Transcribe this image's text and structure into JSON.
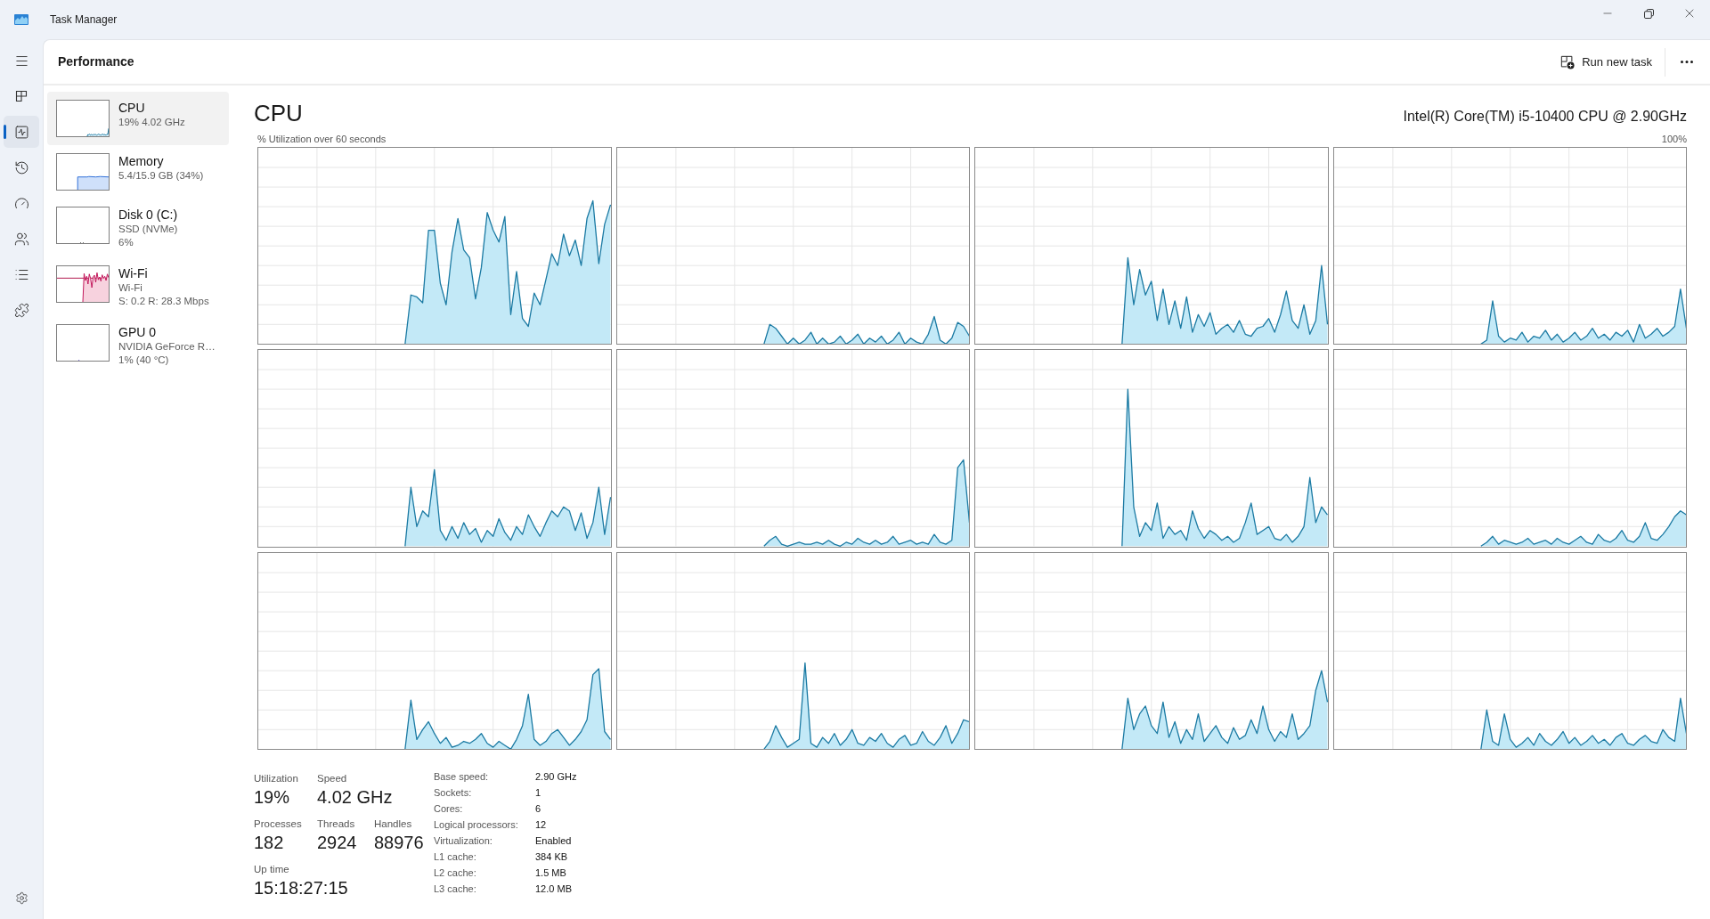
{
  "window": {
    "title": "Task Manager"
  },
  "nav": [
    {
      "selected": false
    },
    {
      "selected": true
    },
    {
      "selected": false
    },
    {
      "selected": false
    },
    {
      "selected": false
    },
    {
      "selected": false
    },
    {
      "selected": false
    }
  ],
  "header": {
    "title": "Performance",
    "action": "Run new task"
  },
  "devices": [
    {
      "kind": "cpu",
      "name": "CPU",
      "details": [
        "19% 4.02 GHz"
      ],
      "selected": true
    },
    {
      "kind": "memory",
      "name": "Memory",
      "details": [
        "5.4/15.9 GB (34%)"
      ],
      "selected": false
    },
    {
      "kind": "disk",
      "name": "Disk 0 (C:)",
      "details": [
        "SSD (NVMe)",
        "6%"
      ],
      "selected": false
    },
    {
      "kind": "network",
      "name": "Wi-Fi",
      "details": [
        "Wi-Fi",
        "S: 0.2 R: 28.3 Mbps"
      ],
      "selected": false
    },
    {
      "kind": "gpu",
      "name": "GPU 0",
      "details": [
        "NVIDIA GeForce R…",
        "1% (40 °C)"
      ],
      "selected": false
    }
  ],
  "detail": {
    "title": "CPU",
    "model": "Intel(R) Core(TM) i5-10400 CPU @ 2.90GHz",
    "graph_caption": "% Utilization over 60 seconds",
    "graph_max": "100%"
  },
  "stats": [
    [
      {
        "label": "Utilization",
        "value": "19%"
      },
      {
        "label": "Speed",
        "value": "4.02 GHz"
      }
    ],
    [
      {
        "label": "Processes",
        "value": "182"
      },
      {
        "label": "Threads",
        "value": "2924"
      },
      {
        "label": "Handles",
        "value": "88976"
      }
    ],
    [
      {
        "label": "Up time",
        "value": "15:18:27:15"
      }
    ]
  ],
  "specs": [
    {
      "label": "Base speed:",
      "value": "2.90 GHz"
    },
    {
      "label": "Sockets:",
      "value": "1"
    },
    {
      "label": "Cores:",
      "value": "6"
    },
    {
      "label": "Logical processors:",
      "value": "12"
    },
    {
      "label": "Virtualization:",
      "value": "Enabled"
    },
    {
      "label": "L1 cache:",
      "value": "384 KB"
    },
    {
      "label": "L2 cache:",
      "value": "1.5 MB"
    },
    {
      "label": "L3 cache:",
      "value": "12.0 MB"
    }
  ]
}
